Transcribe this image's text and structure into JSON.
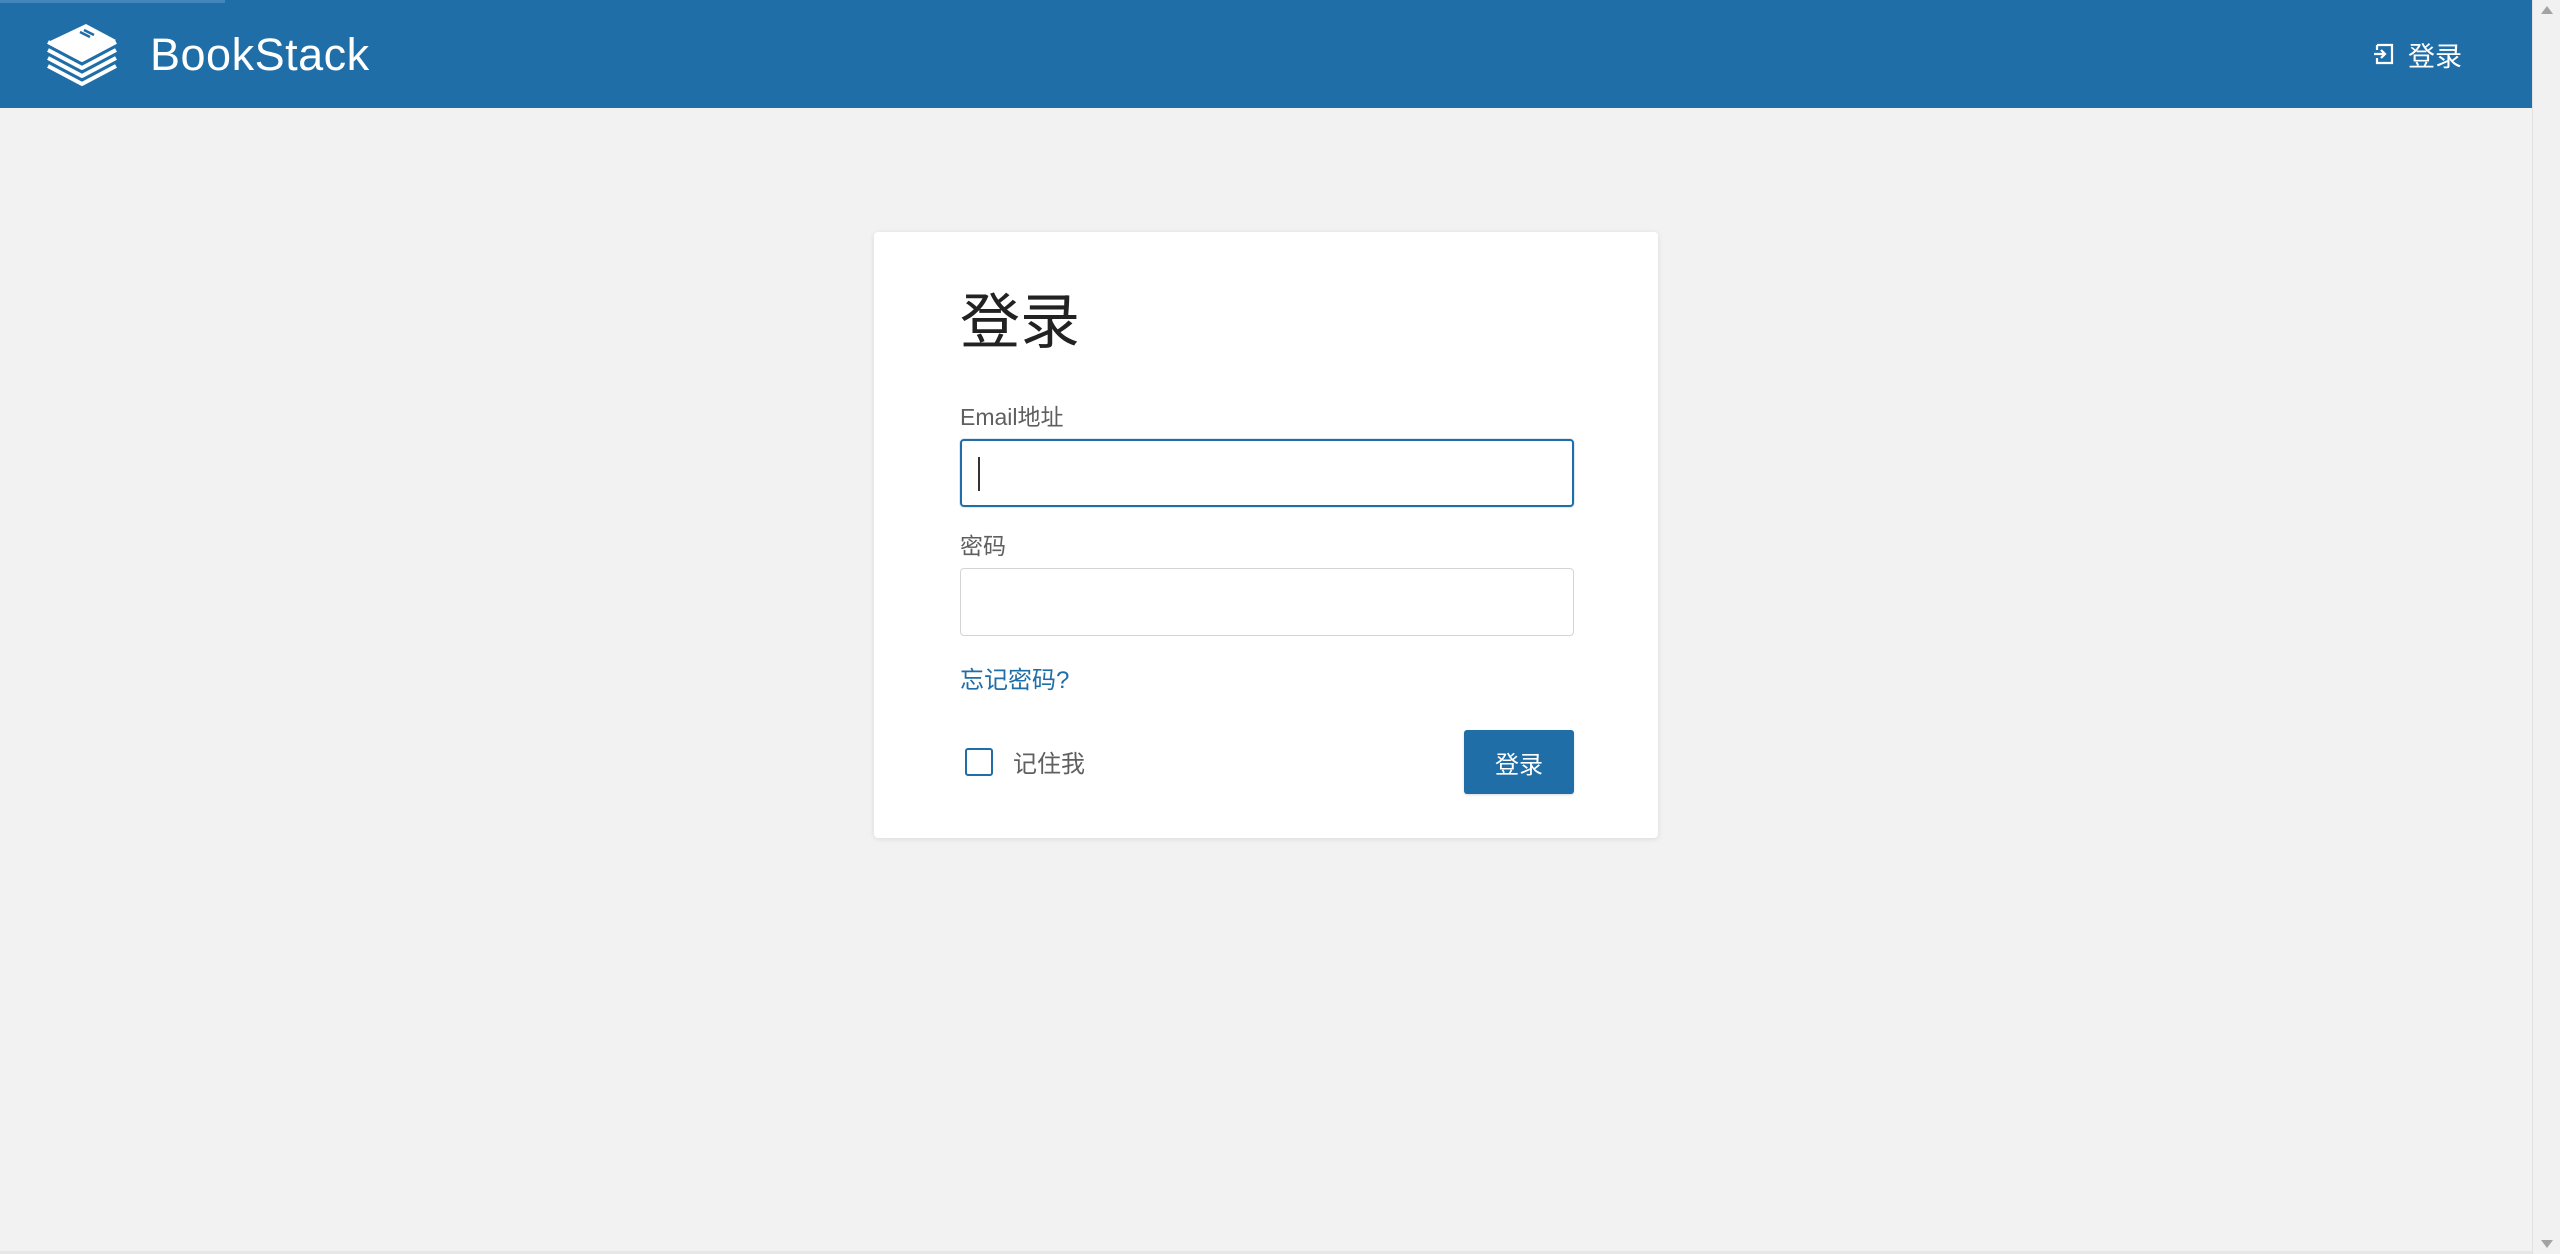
{
  "header": {
    "brand_name": "BookStack",
    "login_label": "登录",
    "logo_icon": "bookstack-logo-icon",
    "login_icon": "login-icon",
    "background_color": "#206ea7"
  },
  "login_form": {
    "title": "登录",
    "email_label": "Email地址",
    "email_value": "",
    "password_label": "密码",
    "password_value": "",
    "forgot_password_link": "忘记密码?",
    "remember_me_label": "记住我",
    "remember_me_checked": false,
    "submit_label": "登录"
  },
  "colors": {
    "accent": "#206ea7",
    "page_background": "#f2f2f2",
    "card_background": "#ffffff"
  }
}
